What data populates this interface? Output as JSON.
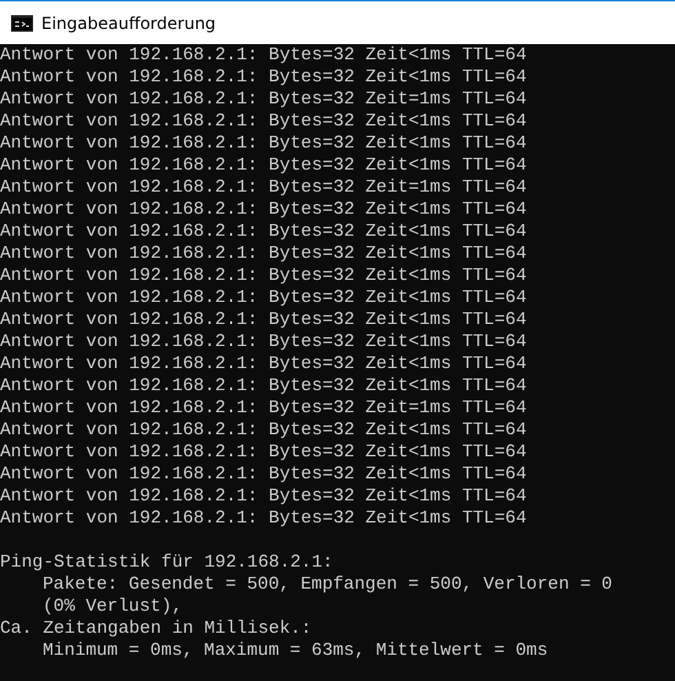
{
  "window": {
    "title": "Eingabeaufforderung"
  },
  "reply_lines": [
    "Antwort von 192.168.2.1: Bytes=32 Zeit<1ms TTL=64",
    "Antwort von 192.168.2.1: Bytes=32 Zeit<1ms TTL=64",
    "Antwort von 192.168.2.1: Bytes=32 Zeit=1ms TTL=64",
    "Antwort von 192.168.2.1: Bytes=32 Zeit<1ms TTL=64",
    "Antwort von 192.168.2.1: Bytes=32 Zeit<1ms TTL=64",
    "Antwort von 192.168.2.1: Bytes=32 Zeit<1ms TTL=64",
    "Antwort von 192.168.2.1: Bytes=32 Zeit=1ms TTL=64",
    "Antwort von 192.168.2.1: Bytes=32 Zeit<1ms TTL=64",
    "Antwort von 192.168.2.1: Bytes=32 Zeit<1ms TTL=64",
    "Antwort von 192.168.2.1: Bytes=32 Zeit<1ms TTL=64",
    "Antwort von 192.168.2.1: Bytes=32 Zeit<1ms TTL=64",
    "Antwort von 192.168.2.1: Bytes=32 Zeit<1ms TTL=64",
    "Antwort von 192.168.2.1: Bytes=32 Zeit<1ms TTL=64",
    "Antwort von 192.168.2.1: Bytes=32 Zeit<1ms TTL=64",
    "Antwort von 192.168.2.1: Bytes=32 Zeit<1ms TTL=64",
    "Antwort von 192.168.2.1: Bytes=32 Zeit<1ms TTL=64",
    "Antwort von 192.168.2.1: Bytes=32 Zeit=1ms TTL=64",
    "Antwort von 192.168.2.1: Bytes=32 Zeit<1ms TTL=64",
    "Antwort von 192.168.2.1: Bytes=32 Zeit<1ms TTL=64",
    "Antwort von 192.168.2.1: Bytes=32 Zeit<1ms TTL=64",
    "Antwort von 192.168.2.1: Bytes=32 Zeit<1ms TTL=64",
    "Antwort von 192.168.2.1: Bytes=32 Zeit<1ms TTL=64"
  ],
  "statistics": [
    {
      "text": "Ping-Statistik für 192.168.2.1:",
      "indented": false
    },
    {
      "text": "Pakete: Gesendet = 500, Empfangen = 500, Verloren = 0",
      "indented": true
    },
    {
      "text": "(0% Verlust),",
      "indented": true
    },
    {
      "text": "Ca. Zeitangaben in Millisek.:",
      "indented": false
    },
    {
      "text": "Minimum = 0ms, Maximum = 63ms, Mittelwert = 0ms",
      "indented": true
    }
  ]
}
